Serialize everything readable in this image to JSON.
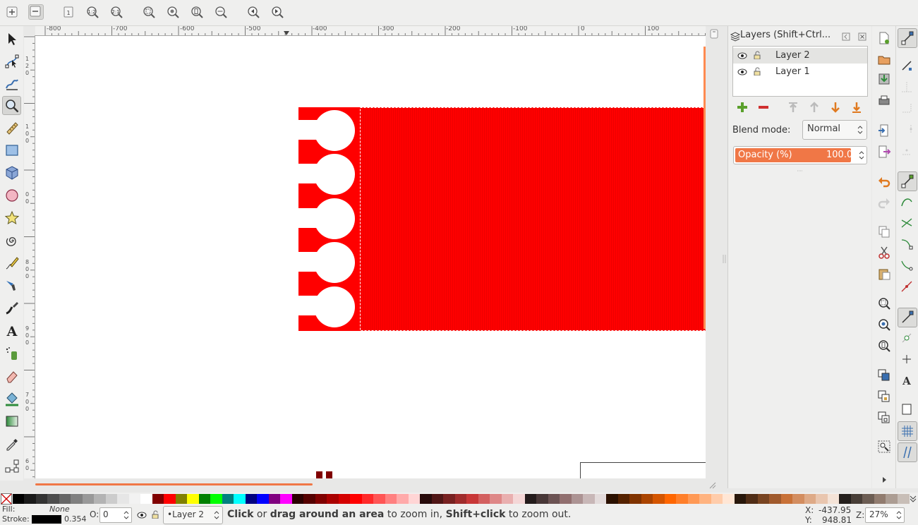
{
  "toolbar": {
    "zoom_buttons": [
      "zoom-in-icon",
      "zoom-out-icon",
      "zoom-1-1-icon",
      "zoom-1-2-icon",
      "zoom-2-1-icon",
      "zoom-selection-icon",
      "zoom-drawing-icon",
      "zoom-page-icon",
      "zoom-page-width-icon",
      "zoom-previous-icon",
      "zoom-next-icon"
    ],
    "zoom_1_2_label": "1:2",
    "zoom_2_1_label": "2:1",
    "zoom_1_1_label": "1:1"
  },
  "ruler": {
    "h_labels": [
      "-800",
      "-700",
      "-600",
      "-500",
      "-400",
      "-300",
      "-200",
      "-100",
      "0",
      "100"
    ],
    "v_labels": [
      "1",
      "2",
      "0",
      "1",
      "0",
      "0",
      "0",
      "0",
      "8",
      "0",
      "0",
      "9",
      "0",
      "0",
      "7",
      "0",
      "0",
      "6",
      "0"
    ]
  },
  "layers_dialog": {
    "title": "Layers (Shift+Ctrl...",
    "layers": [
      {
        "name": "Layer 2",
        "selected": true
      },
      {
        "name": "Layer 1",
        "selected": false
      }
    ],
    "blend_label": "Blend mode:",
    "blend_value": "Normal",
    "opacity_label": "Opacity (%)",
    "opacity_value": "100.0",
    "opacity_fraction": 1.0
  },
  "status": {
    "fill_label": "Fill:",
    "fill_value": "None",
    "stroke_label": "Stroke:",
    "stroke_width": "0.354",
    "opacity_label": "O:",
    "opacity_value": "0",
    "current_layer": "•Layer 2",
    "message_bold_1": "Click",
    "message_1": " or ",
    "message_bold_2": "drag around an area",
    "message_2": " to zoom in, ",
    "message_bold_3": "Shift+click",
    "message_3": " to zoom out.",
    "x_label": "X:",
    "x_value": "-437.95",
    "y_label": "Y:",
    "y_value": "948.81",
    "zoom_label": "Z:",
    "zoom_value": "27%"
  },
  "colors": {
    "accent": "#f07746",
    "canvas_red": "#ff0000",
    "dark_red_glyph": "#800000"
  },
  "palette": [
    "#000000",
    "#1a1a1a",
    "#333333",
    "#4d4d4d",
    "#666666",
    "#808080",
    "#999999",
    "#b3b3b3",
    "#cccccc",
    "#e6e6e6",
    "#f2f2f2",
    "#ffffff",
    "#800000",
    "#ff0000",
    "#808000",
    "#ffff00",
    "#008000",
    "#00ff00",
    "#008080",
    "#00ffff",
    "#000080",
    "#0000ff",
    "#800080",
    "#ff00ff",
    "#2b0000",
    "#550000",
    "#800000",
    "#aa0000",
    "#d40000",
    "#ff0000",
    "#ff2a2a",
    "#ff5555",
    "#ff8080",
    "#ffaaaa",
    "#ffd5d5",
    "#280b0b",
    "#501616",
    "#782121",
    "#a02c2c",
    "#c83737",
    "#d35f5f",
    "#de8787",
    "#e9afaf",
    "#f4d7d7",
    "#241c1c",
    "#483737",
    "#6c5353",
    "#916f6f",
    "#ac9393",
    "#c8b7b7",
    "#e3dbdb",
    "#2b1100",
    "#552200",
    "#803300",
    "#aa4400",
    "#d45500",
    "#ff6600",
    "#ff7f2a",
    "#ff9955",
    "#ffb380",
    "#ffccaa",
    "#ffe6d5",
    "#28170b",
    "#502d16",
    "#784421",
    "#a05a2c",
    "#c87137",
    "#d38d5f",
    "#deaa87",
    "#e9c6af",
    "#f4e3d7",
    "#241f1c",
    "#483e37",
    "#6c5d53",
    "#917c6f",
    "#ac9d93",
    "#c8beb7"
  ]
}
